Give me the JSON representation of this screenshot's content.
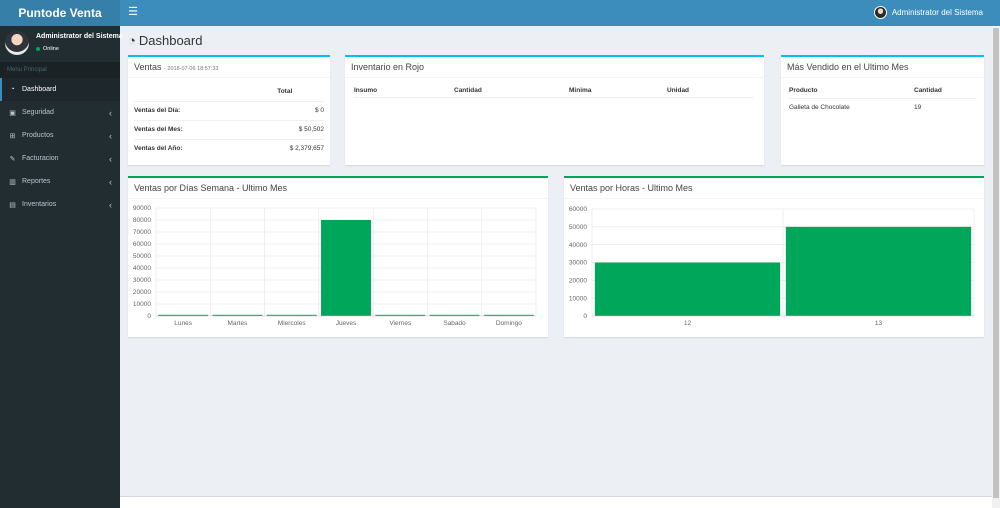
{
  "app": {
    "logo": "Puntode Venta",
    "toggle_icon": "bars-icon"
  },
  "header": {
    "user_name": "Administrator del Sistema"
  },
  "sidebar": {
    "user": {
      "name": "Administrator del Sistema",
      "status": "Online"
    },
    "menu_header": "Menu Principal",
    "items": [
      {
        "label": "Dashboard",
        "icon": "dashboard-icon",
        "active": true
      },
      {
        "label": "Seguridad",
        "icon": "lock-icon"
      },
      {
        "label": "Productos",
        "icon": "cart-icon"
      },
      {
        "label": "Facturacion",
        "icon": "edit-icon"
      },
      {
        "label": "Reportes",
        "icon": "chart-icon"
      },
      {
        "label": "Inventarios",
        "icon": "book-icon"
      }
    ]
  },
  "page": {
    "title": "Dashboard"
  },
  "ventas": {
    "title": "Ventas",
    "subtitle": "- 2018-07-06 18:57:33",
    "col_total": "Total",
    "rows": [
      {
        "label": "Ventas del Día:",
        "value": "$ 0"
      },
      {
        "label": "Ventas del Mes:",
        "value": "$ 50,502"
      },
      {
        "label": "Ventas del Año:",
        "value": "$ 2,379,657"
      }
    ]
  },
  "inventario": {
    "title": "Inventario en Rojo",
    "columns": [
      "Insumo",
      "Cantidad",
      "Minima",
      "Unidad"
    ]
  },
  "mas_vendido": {
    "title": "Más Vendido en el Ultimo Mes",
    "columns": [
      "Producto",
      "Cantidad"
    ],
    "rows": [
      {
        "producto": "Galleta de Chocolate",
        "cantidad": "19"
      }
    ]
  },
  "chart_data": [
    {
      "type": "bar",
      "title": "Ventas por Días Semana - Ultimo Mes",
      "categories": [
        "Lunes",
        "Martes",
        "Miercoles",
        "Jueves",
        "Viernes",
        "Sabado",
        "Domingo"
      ],
      "values": [
        0,
        0,
        0,
        80000,
        0,
        0,
        0
      ],
      "ylim": [
        0,
        90000
      ],
      "yticks": [
        0,
        10000,
        20000,
        30000,
        40000,
        50000,
        60000,
        70000,
        80000,
        90000
      ],
      "color": "#00a65a",
      "grid": true
    },
    {
      "type": "bar",
      "title": "Ventas por Horas - Ultimo Mes",
      "categories": [
        "12",
        "13"
      ],
      "values": [
        30000,
        50000
      ],
      "ylim": [
        0,
        60000
      ],
      "yticks": [
        0,
        10000,
        20000,
        30000,
        40000,
        50000,
        60000
      ],
      "color": "#00a65a",
      "grid": true
    }
  ]
}
